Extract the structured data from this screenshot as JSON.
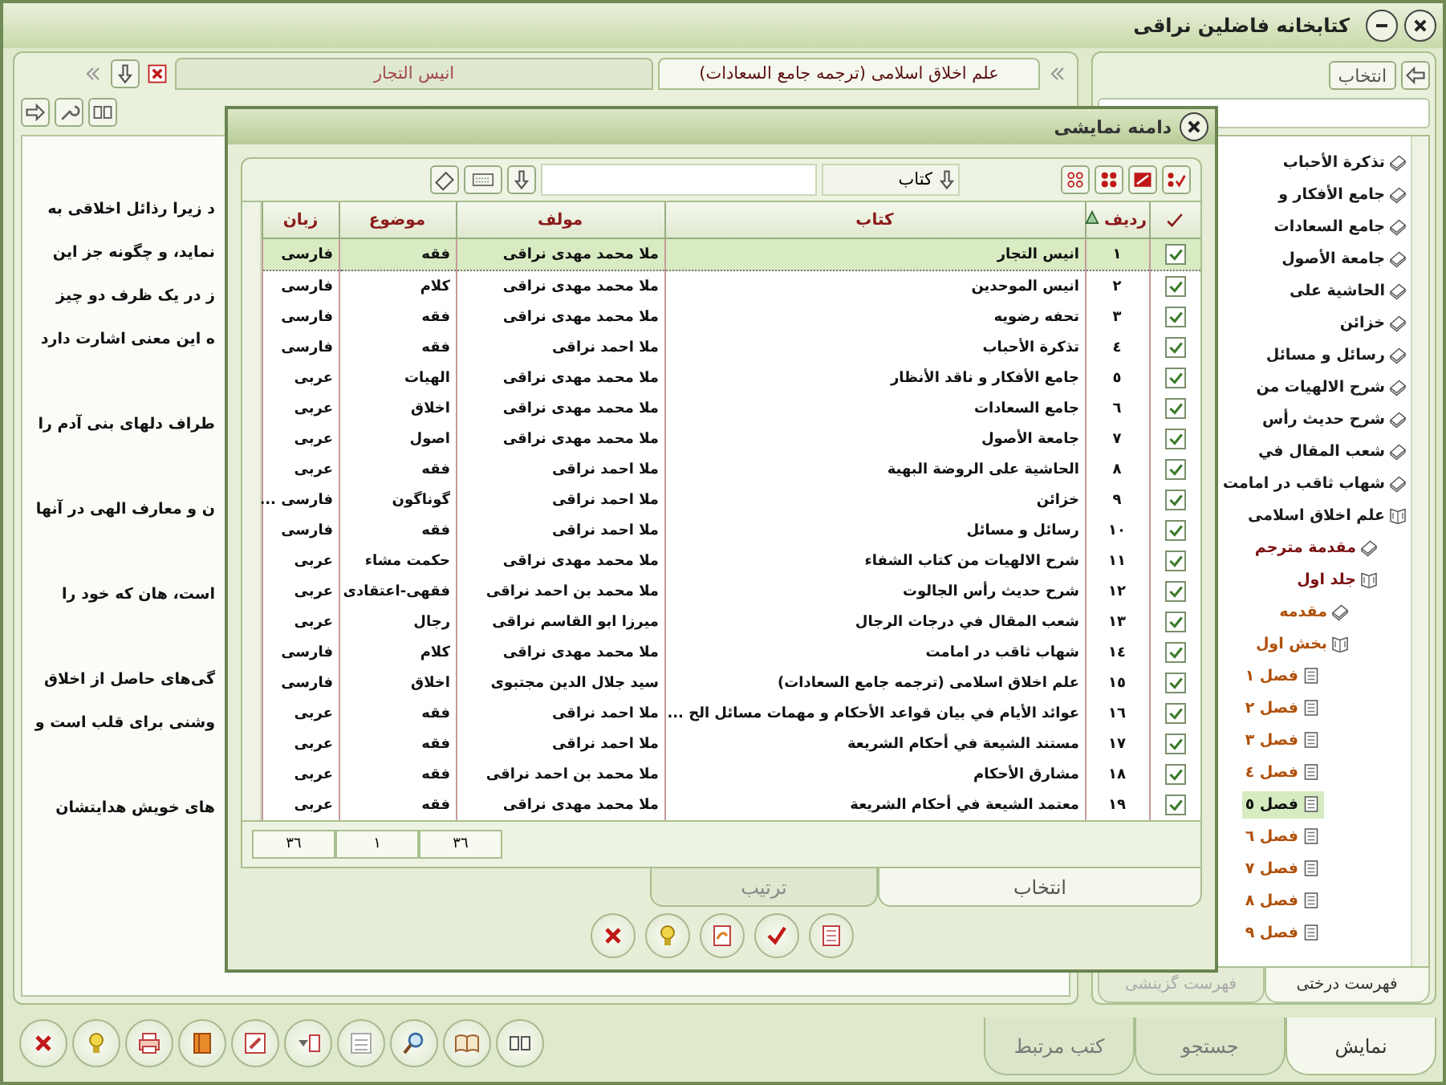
{
  "window": {
    "title": "کتابخانه فاضلین نراقی"
  },
  "document": {
    "tabs": [
      {
        "label": "علم اخلاق اسلامی (ترجمه جامع السعادات)",
        "selected": true
      },
      {
        "label": "انیس التجار",
        "selected": false
      }
    ],
    "paragraphs": [
      [
        "د زیرا رذائل اخلاقی به",
        "نماید، و چگونه جز این",
        "ز در یک ظرف دو چیز",
        "ه این معنی اشارت دارد"
      ],
      [
        "طراف دلهای بنی آدم را"
      ],
      [
        "ن و معارف الهی در آنها"
      ],
      [
        "است، هان که خود را"
      ],
      [
        "گی‌های حاصل از اخلاق",
        "وشنی برای قلب است و"
      ],
      [
        "های خویش هدایتشان"
      ]
    ]
  },
  "contents_panel": {
    "select_button": "انتخاب",
    "tree": [
      {
        "label": "تذکرة الأحباب",
        "kind": "book",
        "selected": false
      },
      {
        "label": "جامع الأفکار و",
        "kind": "book",
        "selected": false
      },
      {
        "label": "جامع السعادات",
        "kind": "book",
        "selected": false
      },
      {
        "label": "جامعة الأصول",
        "kind": "book",
        "selected": false
      },
      {
        "label": "الحاشیة علی",
        "kind": "book",
        "selected": false
      },
      {
        "label": "خزائن",
        "kind": "book",
        "selected": false
      },
      {
        "label": "رسائل و مسائل",
        "kind": "book",
        "selected": false
      },
      {
        "label": "شرح الالهیات من",
        "kind": "book",
        "selected": false
      },
      {
        "label": "شرح حدیث رأس",
        "kind": "book",
        "selected": false
      },
      {
        "label": "شعب المقال في",
        "kind": "book",
        "selected": false
      },
      {
        "label": "شهاب ثاقب در امامت",
        "kind": "book",
        "selected": false
      },
      {
        "label": "علم اخلاق اسلامی",
        "kind": "volume",
        "selected": false,
        "children": [
          {
            "label": "مقدمة مترجم",
            "kind": "book",
            "selected": false
          },
          {
            "label": "جلد اول",
            "kind": "volume",
            "selected": false,
            "children": [
              {
                "label": "مقدمه",
                "kind": "book",
                "selected": false
              },
              {
                "label": "بخش اول",
                "kind": "volume",
                "selected": false,
                "children": [
                  {
                    "label": "فصل ١",
                    "kind": "page",
                    "selected": false
                  },
                  {
                    "label": "فصل ٢",
                    "kind": "page",
                    "selected": false
                  },
                  {
                    "label": "فصل ٣",
                    "kind": "page",
                    "selected": false
                  },
                  {
                    "label": "فصل ٤",
                    "kind": "page",
                    "selected": false
                  },
                  {
                    "label": "فصل ٥",
                    "kind": "page",
                    "selected": true
                  },
                  {
                    "label": "فصل ٦",
                    "kind": "page",
                    "selected": false
                  },
                  {
                    "label": "فصل ٧",
                    "kind": "page",
                    "selected": false
                  },
                  {
                    "label": "فصل ٨",
                    "kind": "page",
                    "selected": false
                  },
                  {
                    "label": "فصل ٩",
                    "kind": "page",
                    "selected": false
                  }
                ]
              }
            ]
          }
        ]
      }
    ],
    "tabs": [
      {
        "label": "فهرست درختی",
        "selected": true
      },
      {
        "label": "فهرست گزینشی",
        "selected": false
      }
    ]
  },
  "dialog": {
    "title": "دامنه نمایشی",
    "filter": {
      "field": "کتاب"
    },
    "columns": [
      {
        "label": "ردیف",
        "sorted": true
      },
      {
        "label": "کتاب",
        "sorted": false
      },
      {
        "label": "مولف",
        "sorted": false
      },
      {
        "label": "موضوع",
        "sorted": false
      },
      {
        "label": "زبان",
        "sorted": false
      }
    ],
    "rows": [
      {
        "checked": true,
        "selected": true,
        "cells": [
          "١",
          "انیس التجار",
          "ملا محمد مهدی نراقی",
          "فقه",
          "فارسی"
        ]
      },
      {
        "checked": true,
        "selected": false,
        "cells": [
          "٢",
          "انیس الموحدین",
          "ملا محمد مهدی نراقی",
          "کلام",
          "فارسی"
        ]
      },
      {
        "checked": true,
        "selected": false,
        "cells": [
          "٣",
          "تحفه رضویه",
          "ملا محمد مهدی نراقی",
          "فقه",
          "فارسی"
        ]
      },
      {
        "checked": true,
        "selected": false,
        "cells": [
          "٤",
          "تذکرة الأحباب",
          "ملا احمد نراقی",
          "فقه",
          "فارسی"
        ]
      },
      {
        "checked": true,
        "selected": false,
        "cells": [
          "٥",
          "جامع الأفکار و ناقد الأنظار",
          "ملا محمد مهدی نراقی",
          "الهیات",
          "عربی"
        ]
      },
      {
        "checked": true,
        "selected": false,
        "cells": [
          "٦",
          "جامع السعادات",
          "ملا محمد مهدی نراقی",
          "اخلاق",
          "عربی"
        ]
      },
      {
        "checked": true,
        "selected": false,
        "cells": [
          "٧",
          "جامعة الأصول",
          "ملا محمد مهدی نراقی",
          "اصول",
          "عربی"
        ]
      },
      {
        "checked": true,
        "selected": false,
        "cells": [
          "٨",
          "الحاشیة علی الروضة البهیة",
          "ملا احمد نراقی",
          "فقه",
          "عربی"
        ]
      },
      {
        "checked": true,
        "selected": false,
        "cells": [
          "٩",
          "خزائن",
          "ملا احمد نراقی",
          "گوناگون",
          "فارسی ..."
        ]
      },
      {
        "checked": true,
        "selected": false,
        "cells": [
          "١٠",
          "رسائل و مسائل",
          "ملا احمد نراقی",
          "فقه",
          "فارسی"
        ]
      },
      {
        "checked": true,
        "selected": false,
        "cells": [
          "١١",
          "شرح الالهیات من کتاب الشفاء",
          "ملا محمد مهدی نراقی",
          "حکمت مشاء",
          "عربی"
        ]
      },
      {
        "checked": true,
        "selected": false,
        "cells": [
          "١٢",
          "شرح حدیث رأس الجالوت",
          "ملا محمد بن احمد نراقی",
          "فقهی-اعتقادی",
          "عربی"
        ]
      },
      {
        "checked": true,
        "selected": false,
        "cells": [
          "١٣",
          "شعب المقال في درجات الرجال",
          "میرزا ابو القاسم نراقی",
          "رجال",
          "عربی"
        ]
      },
      {
        "checked": true,
        "selected": false,
        "cells": [
          "١٤",
          "شهاب ثاقب در امامت",
          "ملا محمد مهدی نراقی",
          "کلام",
          "فارسی"
        ]
      },
      {
        "checked": true,
        "selected": false,
        "cells": [
          "١٥",
          "علم اخلاق اسلامی (ترجمه جامع السعادات)",
          "سید جلال الدین مجتبوی",
          "اخلاق",
          "فارسی"
        ]
      },
      {
        "checked": true,
        "selected": false,
        "cells": [
          "١٦",
          "عوائد الأیام في بیان قواعد الأحکام و مهمات مسائل الح ...",
          "ملا احمد نراقی",
          "فقه",
          "عربی"
        ]
      },
      {
        "checked": true,
        "selected": false,
        "cells": [
          "١٧",
          "مستند الشیعة في أحکام الشریعة",
          "ملا احمد نراقی",
          "فقه",
          "عربی"
        ]
      },
      {
        "checked": true,
        "selected": false,
        "cells": [
          "١٨",
          "مشارق الأحکام",
          "ملا محمد بن احمد نراقی",
          "فقه",
          "عربی"
        ]
      },
      {
        "checked": true,
        "selected": false,
        "cells": [
          "١٩",
          "معتمد الشیعة في أحکام الشریعة",
          "ملا محمد مهدی نراقی",
          "فقه",
          "عربی"
        ]
      }
    ],
    "footer": [
      "٣٦",
      "١",
      "٣٦"
    ],
    "tabs": [
      {
        "label": "انتخاب",
        "selected": true
      },
      {
        "label": "ترتیب",
        "selected": false
      }
    ]
  },
  "bottom_tabs": [
    {
      "label": "نمایش",
      "selected": true
    },
    {
      "label": "جستجو",
      "selected": false
    },
    {
      "label": "کتب مرتبط",
      "selected": false
    }
  ]
}
